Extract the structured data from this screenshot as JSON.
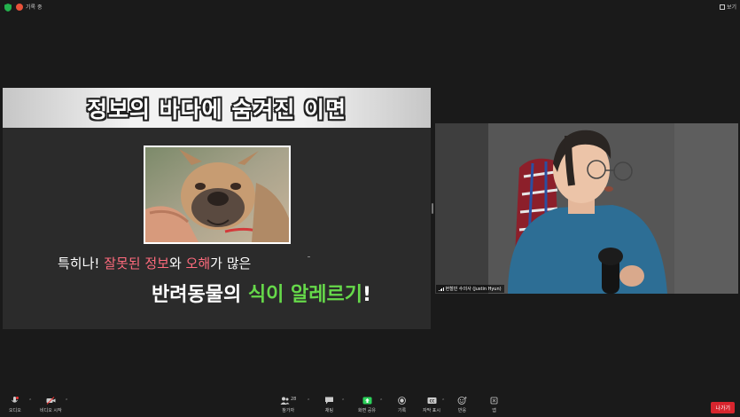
{
  "topbar": {
    "recording_label": "기록 중",
    "view_label": "보기"
  },
  "slide": {
    "title": "정보의 바다에 숨겨진 이면",
    "line1_parts": [
      "특히나! ",
      "잘못된 정보",
      "와 ",
      "오해",
      "가 많은"
    ],
    "line2_parts": [
      "반려동물의 ",
      "식이 알레르기",
      "!"
    ]
  },
  "video": {
    "participant_name": "현철민 수의사 (Justin Hyun)"
  },
  "toolbar": {
    "audio_label": "오디오",
    "video_label": "비디오 시작",
    "participants_label": "참가자",
    "participants_count": "28",
    "chat_label": "채팅",
    "share_label": "화면 공유",
    "record_label": "기록",
    "captions_label": "자막 표시",
    "reactions_label": "반응",
    "apps_label": "앱",
    "leave_label": "나가기"
  },
  "colors": {
    "accent_pink": "#ff6b7d",
    "accent_green": "#66d94a",
    "share_green": "#2bd15a",
    "leave_red": "#d8252e"
  }
}
